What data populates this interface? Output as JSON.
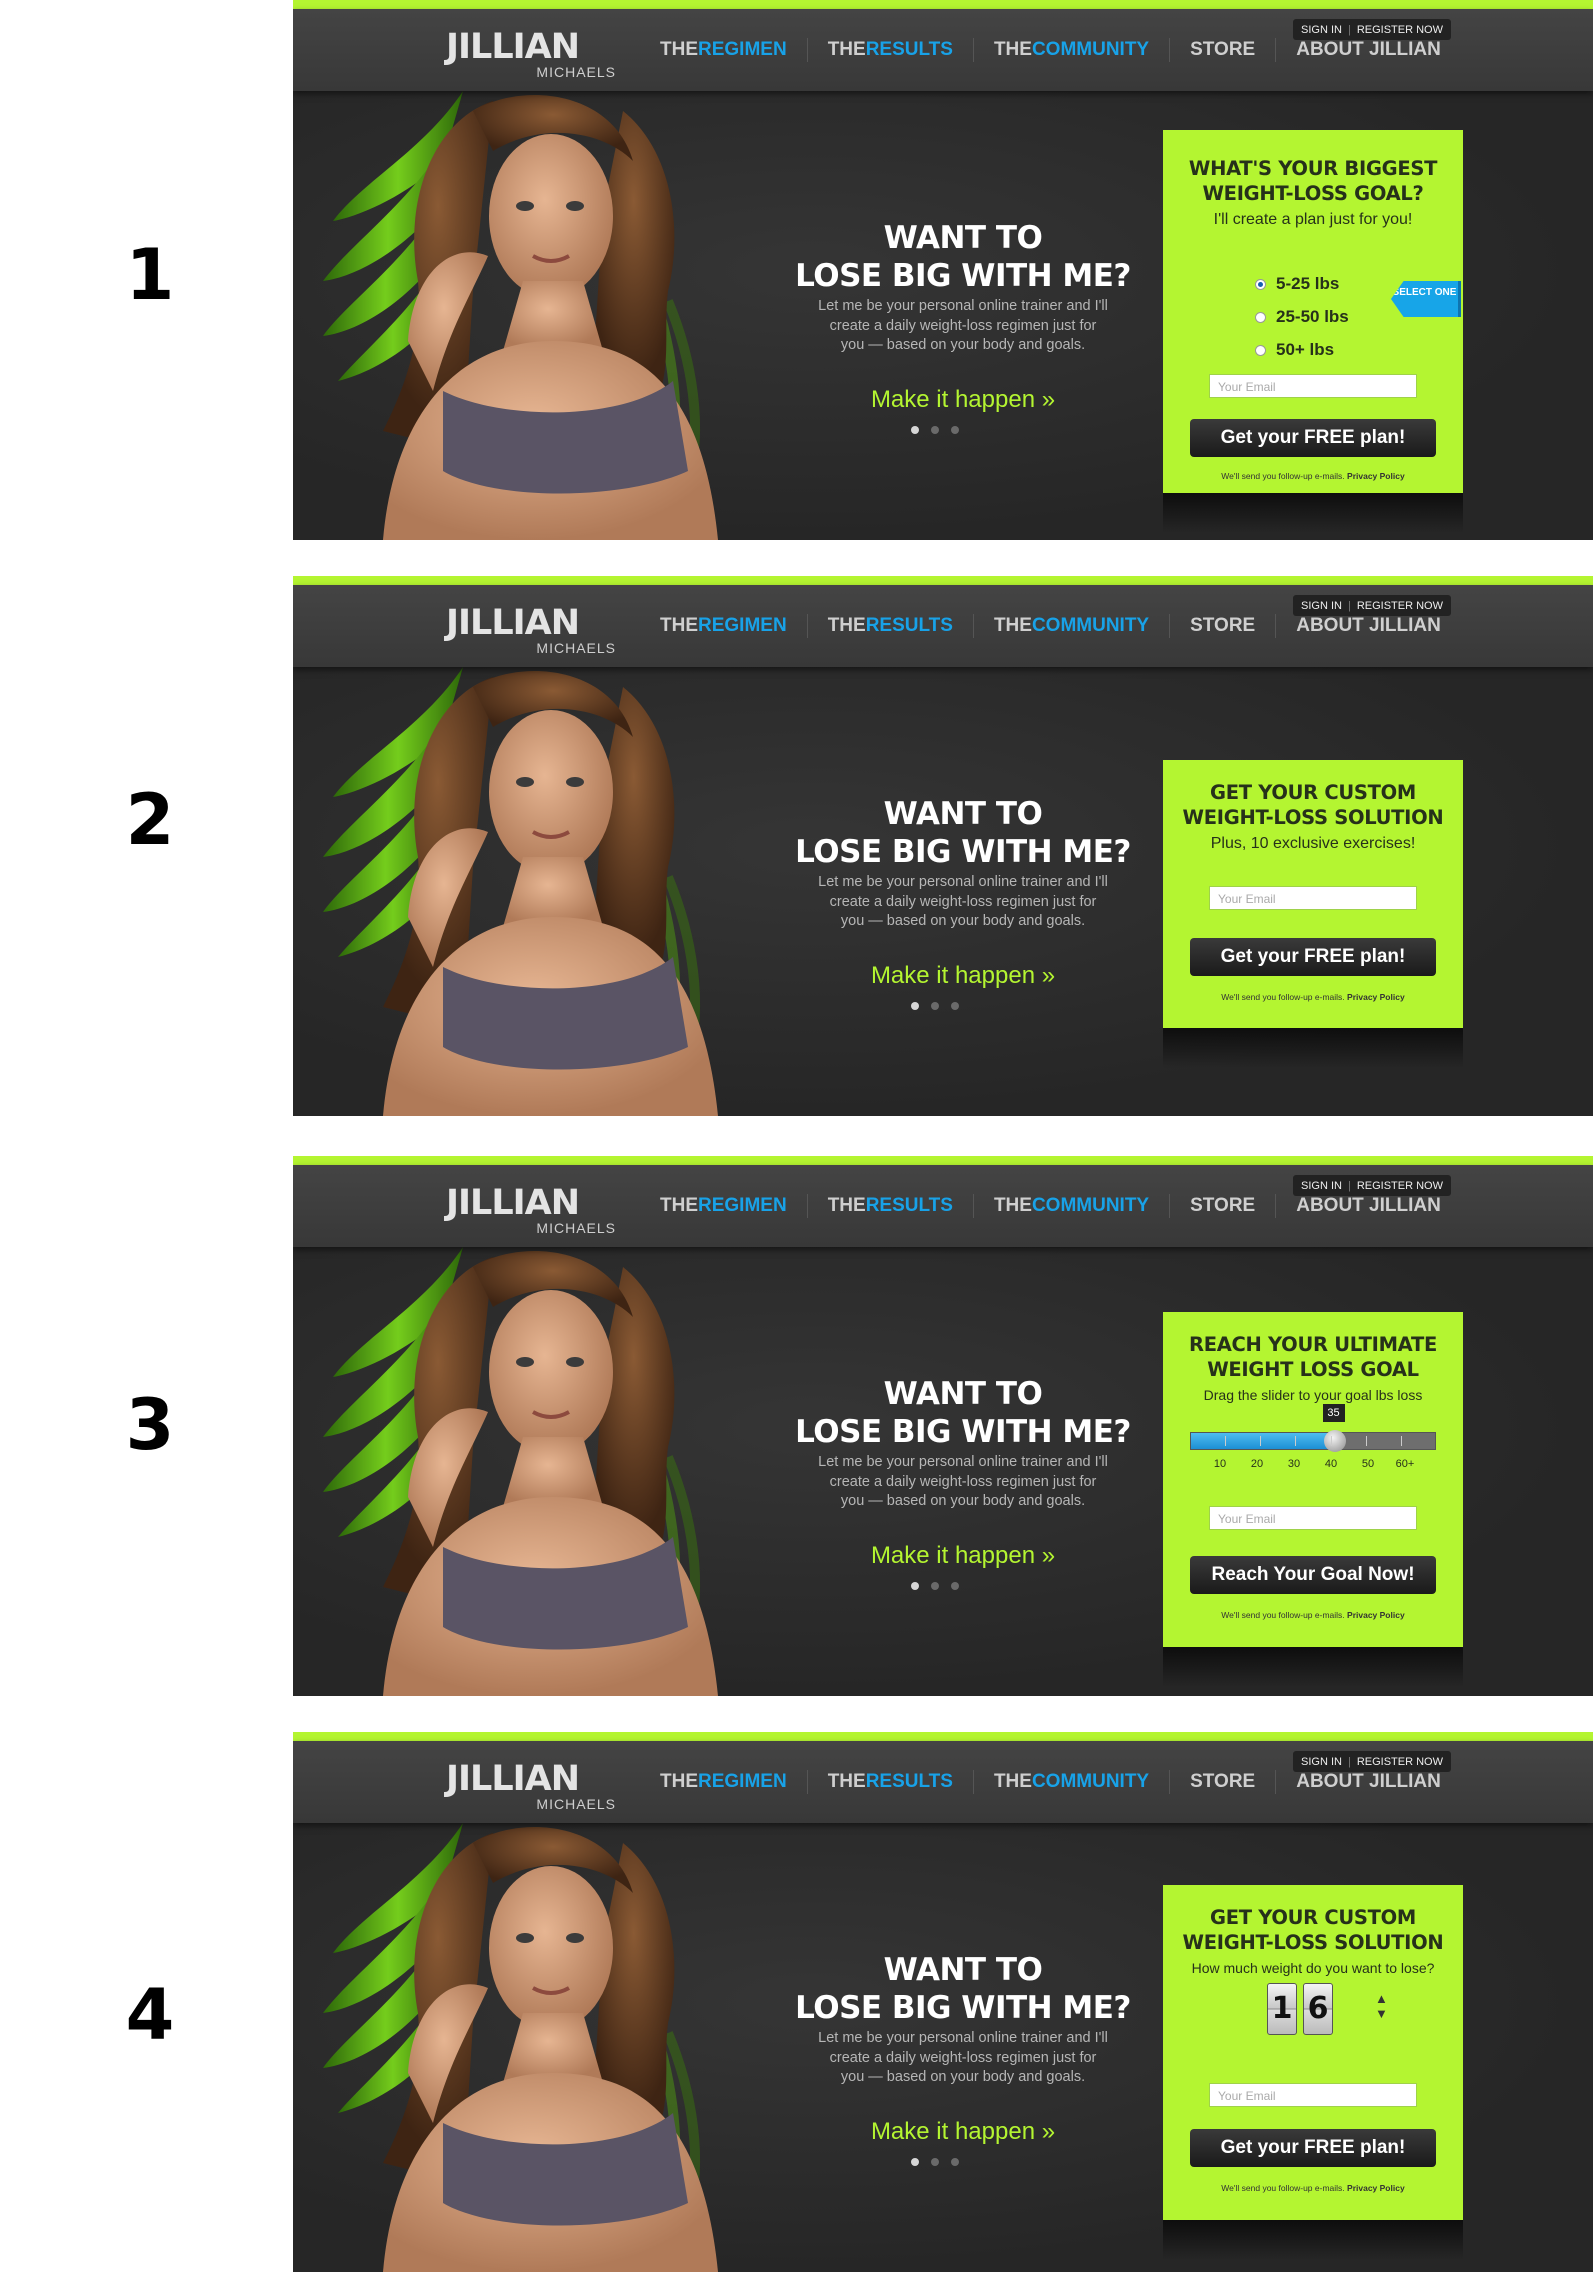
{
  "labels": [
    "1",
    "2",
    "3",
    "4"
  ],
  "header": {
    "logo_main": "JILLIAN",
    "logo_sub": "MICHAELS",
    "sign_in": "SIGN IN",
    "register": "REGISTER NOW",
    "nav": [
      {
        "pre": "THE",
        "hi": "REGIMEN"
      },
      {
        "pre": "THE",
        "hi": "RESULTS"
      },
      {
        "pre": "THE",
        "hi": "COMMUNITY"
      },
      {
        "plain": "STORE"
      },
      {
        "plain": "ABOUT JILLIAN"
      }
    ]
  },
  "hero": {
    "headline_line1": "WANT TO",
    "headline_line2": "LOSE BIG WITH ME?",
    "desc_line1": "Let me be your personal online trainer and I'll",
    "desc_line2": "create a daily weight-loss regimen just for",
    "desc_line3": "you — based on your body and goals.",
    "cta": "Make it happen »",
    "active_dot": 1,
    "dot_count": 3
  },
  "colors": {
    "accent_green": "#b4f531",
    "accent_blue": "#18a2e8",
    "dark_bg": "#2b2b2b"
  },
  "variants": [
    {
      "title_line1": "WHAT'S YOUR BIGGEST",
      "title_line2": "WEIGHT-LOSS GOAL?",
      "subtitle": "I'll create a plan just for you!",
      "options": [
        "5-25 lbs",
        "25-50 lbs",
        "50+ lbs"
      ],
      "selected_option": 0,
      "select_tag": "SELECT ONE",
      "email_placeholder": "Your Email",
      "button": "Get your FREE plan!",
      "fine": "We'll send you follow-up e-mails.",
      "privacy": "Privacy Policy"
    },
    {
      "title_line1": "GET YOUR CUSTOM",
      "title_line2": "WEIGHT-LOSS SOLUTION",
      "subtitle": "Plus, 10 exclusive exercises!",
      "email_placeholder": "Your Email",
      "button": "Get your FREE plan!",
      "fine": "We'll send you follow-up e-mails.",
      "privacy": "Privacy Policy"
    },
    {
      "title_line1": "REACH YOUR ULTIMATE",
      "title_line2": "WEIGHT LOSS GOAL",
      "subtitle": "Drag the slider to your goal lbs loss",
      "slider_value": "35",
      "slider_labels": [
        "10",
        "20",
        "30",
        "40",
        "50",
        "60+"
      ],
      "email_placeholder": "Your Email",
      "button": "Reach Your Goal Now!",
      "fine": "We'll send you follow-up e-mails.",
      "privacy": "Privacy Policy"
    },
    {
      "title_line1": "GET YOUR CUSTOM",
      "title_line2": "WEIGHT-LOSS SOLUTION",
      "subtitle": "How much weight do you want to lose?",
      "counter_digits": [
        "1",
        "6"
      ],
      "email_placeholder": "Your Email",
      "button": "Get your FREE plan!",
      "fine": "We'll send you follow-up e-mails.",
      "privacy": "Privacy Policy"
    }
  ]
}
